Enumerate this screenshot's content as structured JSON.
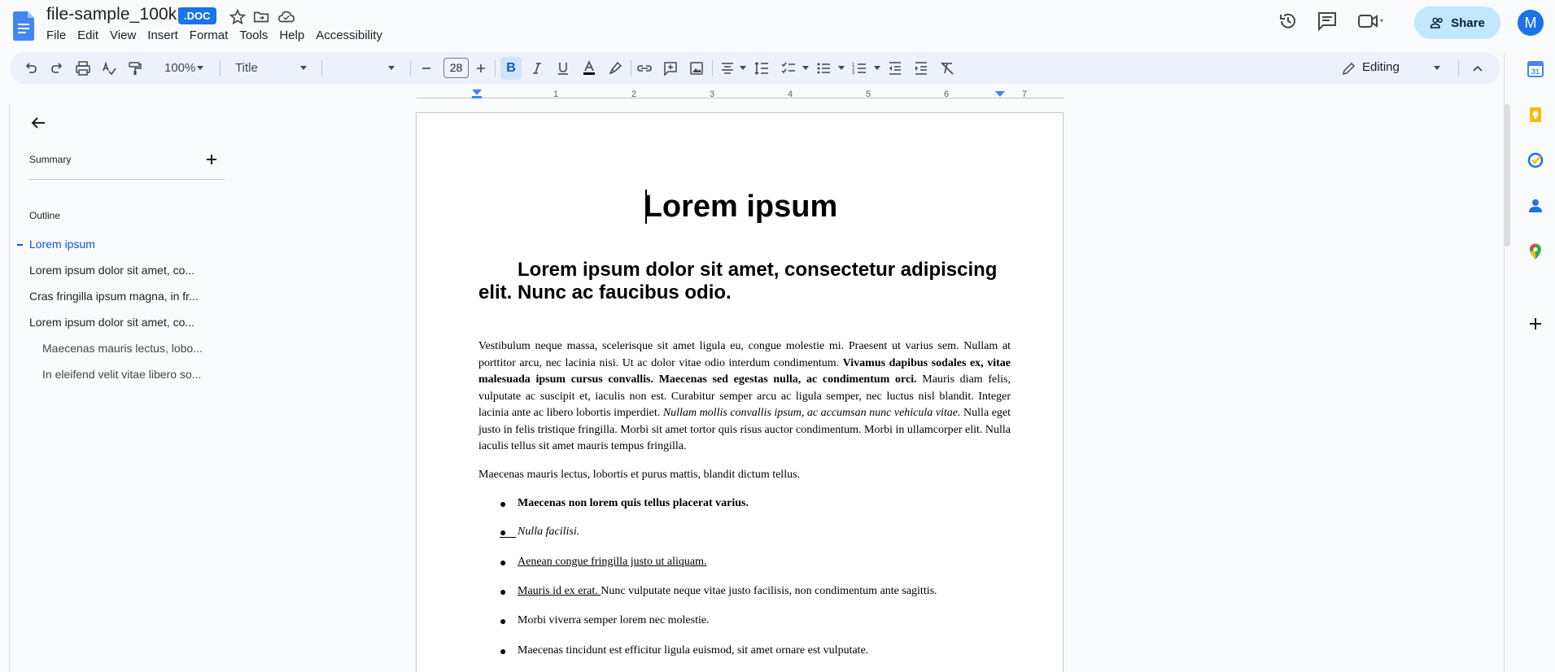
{
  "titlebar": {
    "doc_name": "file-sample_100kB",
    "doc_badge": ".DOC",
    "menu": [
      "File",
      "Edit",
      "View",
      "Insert",
      "Format",
      "Tools",
      "Help",
      "Accessibility"
    ],
    "share_label": "Share",
    "avatar_initial": "M"
  },
  "toolbar": {
    "zoom": "100%",
    "style": "Title",
    "font_size": "28",
    "bold_label": "B",
    "mode": "Editing"
  },
  "ruler": [
    "1",
    "2",
    "3",
    "4",
    "5",
    "6",
    "7"
  ],
  "outline_panel": {
    "summary_label": "Summary",
    "outline_label": "Outline",
    "items": [
      {
        "label": "Lorem ipsum",
        "level": 1,
        "active": true
      },
      {
        "label": "Lorem ipsum dolor sit amet, co...",
        "level": 1,
        "active": false
      },
      {
        "label": "Cras fringilla ipsum magna, in fr...",
        "level": 1,
        "active": false
      },
      {
        "label": "Lorem ipsum dolor sit amet, co...",
        "level": 1,
        "active": false
      },
      {
        "label": "Maecenas mauris lectus, lobo...",
        "level": 2,
        "active": false
      },
      {
        "label": "In eleifend velit vitae libero so...",
        "level": 2,
        "active": false
      }
    ]
  },
  "document": {
    "title": "Lorem ipsum",
    "heading1": "Lorem ipsum dolor sit amet, consectetur adipiscing elit. Nunc ac faucibus odio.",
    "para1_a": "Vestibulum neque massa, scelerisque sit amet ligula eu, congue molestie mi. Praesent ut varius sem. Nullam at porttitor arcu, nec lacinia nisi. Ut ac dolor vitae odio interdum condimentum. ",
    "para1_b": "Vivamus dapibus sodales ex, vitae malesuada ipsum cursus convallis. Maecenas sed egestas nulla, ac condimentum orci.",
    "para1_c": " Mauris diam felis, vulputate ac suscipit et, iaculis non est. Curabitur semper arcu ac ligula semper, nec luctus nisl blandit. Integer lacinia ante ac libero lobortis imperdiet. ",
    "para1_d": "Nullam mollis convallis ipsum, ac accumsan nunc vehicula vitae.",
    "para1_e": " Nulla eget justo in felis tristique fringilla. Morbi sit amet tortor quis risus auctor condimentum. Morbi in ullamcorper elit. Nulla iaculis tellus sit amet mauris tempus fringilla.",
    "para2": "Maecenas mauris lectus, lobortis et purus mattis, blandit dictum tellus.",
    "bullets": {
      "b1": "Maecenas non lorem quis tellus placerat varius.",
      "b2": "Nulla facilisi.",
      "b3": "Aenean congue fringilla justo ut aliquam.",
      "b4_a": "Mauris id ex erat. ",
      "b4_b": "Nunc vulputate neque vitae justo facilisis, non condimentum ante sagittis.",
      "b5": "Morbi viverra semper lorem nec molestie.",
      "b6": "Maecenas tincidunt est efficitur ligula euismod, sit amet ornare est vulputate."
    }
  },
  "colors": {
    "accent": "#0b57d0",
    "share_bg": "#c2e7ff",
    "toolbar_bg": "#edf2fa",
    "badge_bg": "#1a73e8"
  }
}
